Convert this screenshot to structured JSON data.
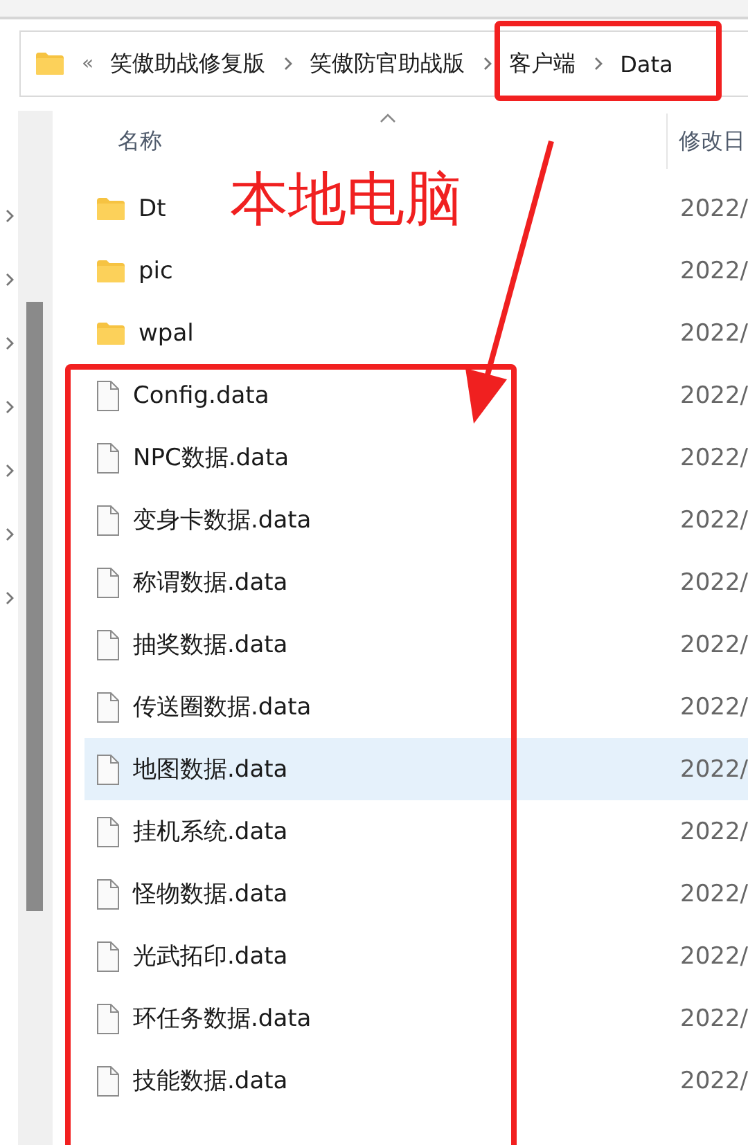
{
  "breadcrumb": {
    "overflow": "«",
    "segments": [
      "笑傲助战修复版",
      "笑傲防官助战版",
      "客户端",
      "Data"
    ]
  },
  "columns": [
    {
      "label": "名称",
      "sorted": true
    },
    {
      "label": "修改日"
    }
  ],
  "rows": [
    {
      "kind": "folder",
      "name": "Dt",
      "date": "2022/",
      "selected": false
    },
    {
      "kind": "folder",
      "name": "pic",
      "date": "2022/",
      "selected": false
    },
    {
      "kind": "folder",
      "name": "wpal",
      "date": "2022/",
      "selected": false
    },
    {
      "kind": "file",
      "name": "Config.data",
      "date": "2022/",
      "selected": false
    },
    {
      "kind": "file",
      "name": "NPC数据.data",
      "date": "2022/",
      "selected": false
    },
    {
      "kind": "file",
      "name": "变身卡数据.data",
      "date": "2022/",
      "selected": false
    },
    {
      "kind": "file",
      "name": "称谓数据.data",
      "date": "2022/",
      "selected": false
    },
    {
      "kind": "file",
      "name": "抽奖数据.data",
      "date": "2022/",
      "selected": false
    },
    {
      "kind": "file",
      "name": "传送圈数据.data",
      "date": "2022/",
      "selected": false
    },
    {
      "kind": "file",
      "name": "地图数据.data",
      "date": "2022/",
      "selected": true
    },
    {
      "kind": "file",
      "name": "挂机系统.data",
      "date": "2022/",
      "selected": false
    },
    {
      "kind": "file",
      "name": "怪物数据.data",
      "date": "2022/",
      "selected": false
    },
    {
      "kind": "file",
      "name": "光武拓印.data",
      "date": "2022/",
      "selected": false
    },
    {
      "kind": "file",
      "name": "环任务数据.data",
      "date": "2022/",
      "selected": false
    },
    {
      "kind": "file",
      "name": "技能数据.data",
      "date": "2022/",
      "selected": false
    }
  ],
  "annotation": {
    "label": "本地电脑"
  }
}
